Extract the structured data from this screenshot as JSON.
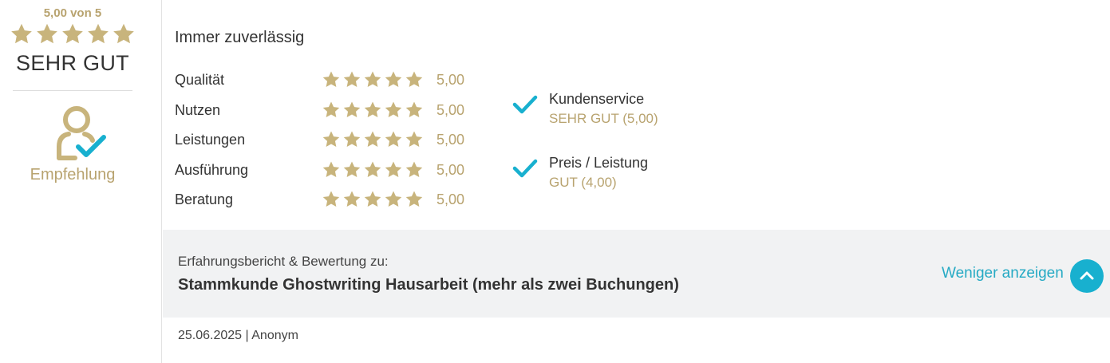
{
  "summary": {
    "score_text": "5,00 von 5",
    "verdict": "SEHR GUT",
    "recommendation_label": "Empfehlung",
    "star_rating": 5
  },
  "review": {
    "headline": "Immer zuverlässig",
    "criteria": [
      {
        "label": "Qualität",
        "value": "5,00",
        "stars": 5
      },
      {
        "label": "Nutzen",
        "value": "5,00",
        "stars": 5
      },
      {
        "label": "Leistungen",
        "value": "5,00",
        "stars": 5
      },
      {
        "label": "Ausführung",
        "value": "5,00",
        "stars": 5
      },
      {
        "label": "Beratung",
        "value": "5,00",
        "stars": 5
      }
    ],
    "extras": [
      {
        "label": "Kundenservice",
        "value": "SEHR GUT (5,00)"
      },
      {
        "label": "Preis / Leistung",
        "value": "GUT (4,00)"
      }
    ]
  },
  "band": {
    "label": "Erfahrungsbericht & Bewertung zu:",
    "title": "Stammkunde Ghostwriting Hausarbeit (mehr als zwei Buchungen)",
    "less_link": "Weniger anzeigen"
  },
  "meta": {
    "text": "25.06.2025 | Anonym"
  },
  "colors": {
    "gold": "#c8b47c",
    "accent": "#18b0cf",
    "band_bg": "#f1f2f3"
  }
}
